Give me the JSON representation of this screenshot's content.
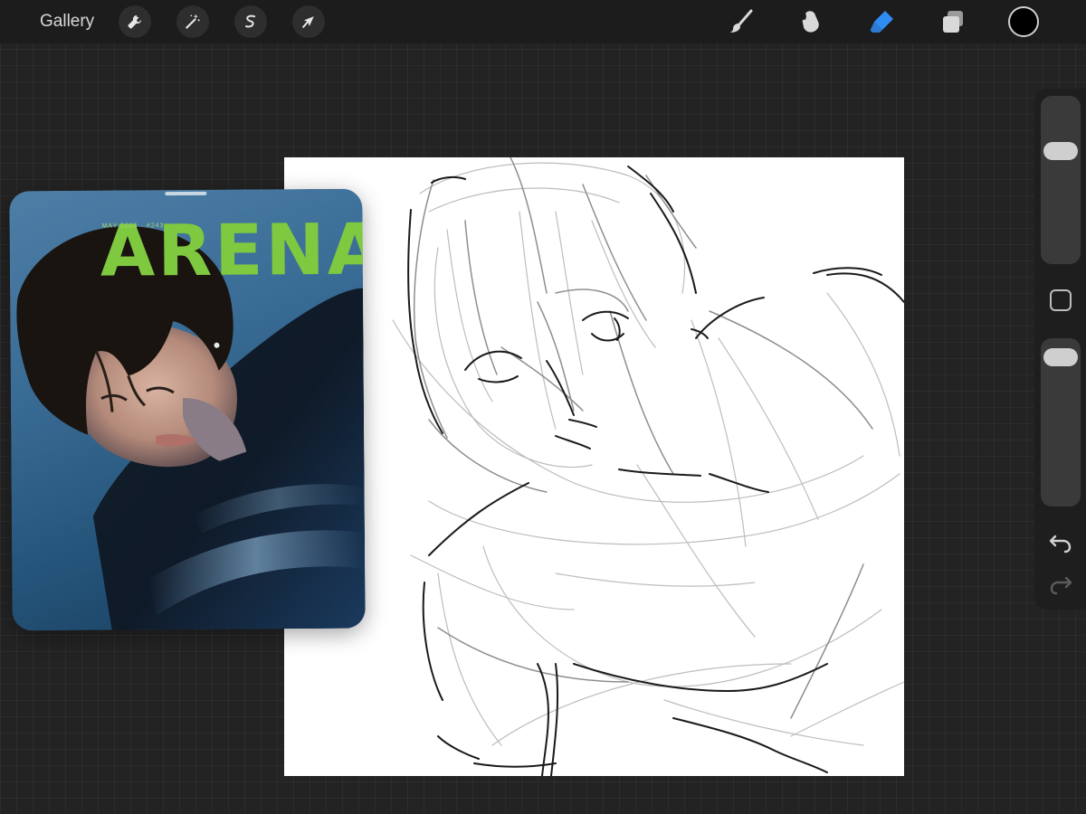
{
  "toolbar": {
    "gallery_label": "Gallery",
    "left_tools": [
      {
        "name": "actions",
        "icon": "wrench-icon"
      },
      {
        "name": "adjustments",
        "icon": "magic-wand-icon"
      },
      {
        "name": "selection",
        "icon": "selection-s-icon"
      },
      {
        "name": "transform",
        "icon": "arrow-cursor-icon"
      }
    ],
    "right_tools": [
      {
        "name": "brush",
        "icon": "brush-icon",
        "active": false
      },
      {
        "name": "smudge",
        "icon": "smudge-finger-icon",
        "active": false
      },
      {
        "name": "eraser",
        "icon": "eraser-icon",
        "active": true
      },
      {
        "name": "layers",
        "icon": "layers-icon",
        "active": false
      }
    ],
    "current_color": "#000000",
    "active_tool_color": "#2f8cf0"
  },
  "reference": {
    "masthead": "ARENA",
    "issue_line": "MAY 2026 · #243",
    "masthead_color": "#7ec940"
  },
  "sidebar": {
    "brush_size_level": 0.7,
    "opacity_level": 0.95,
    "icons": [
      "modify-square-icon",
      "undo-icon",
      "redo-icon"
    ]
  }
}
